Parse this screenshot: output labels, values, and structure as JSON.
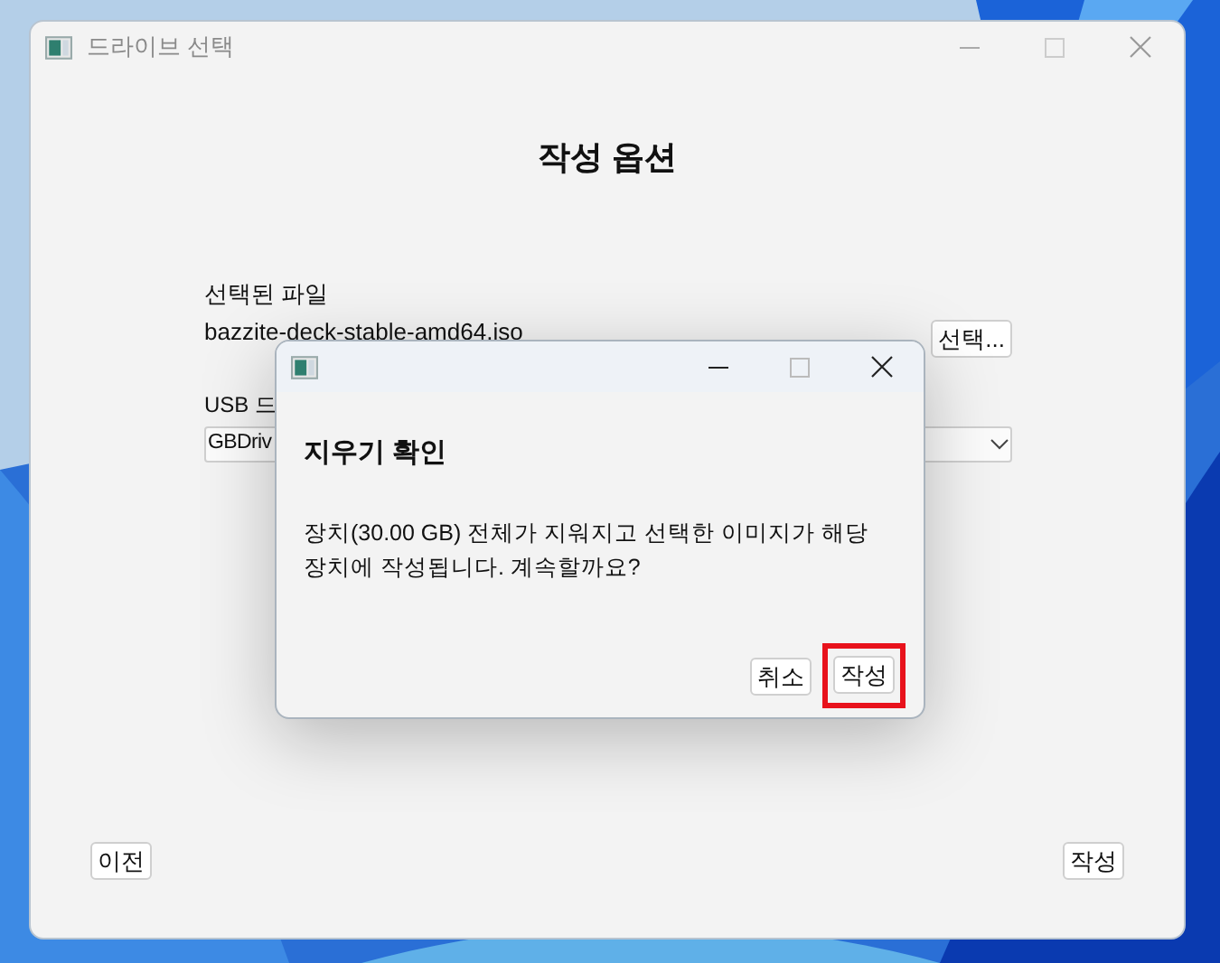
{
  "window": {
    "title": "드라이브 선택",
    "heading": "작성 옵션"
  },
  "file": {
    "label": "선택된 파일",
    "value": "bazzite-deck-stable-amd64.iso",
    "button": "선택..."
  },
  "drive": {
    "label": "USB 드",
    "value": "GBDriv"
  },
  "footer": {
    "back": "이전",
    "write": "작성"
  },
  "dialog": {
    "heading": "지우기 확인",
    "message": "장치(30.00 GB) 전체가 지워지고 선택한 이미지가 해당\n장치에 작성됩니다. 계속할까요?",
    "buttons": [
      {
        "label": "취소",
        "highlighted": false
      },
      {
        "label": "작성",
        "highlighted": true
      }
    ]
  }
}
